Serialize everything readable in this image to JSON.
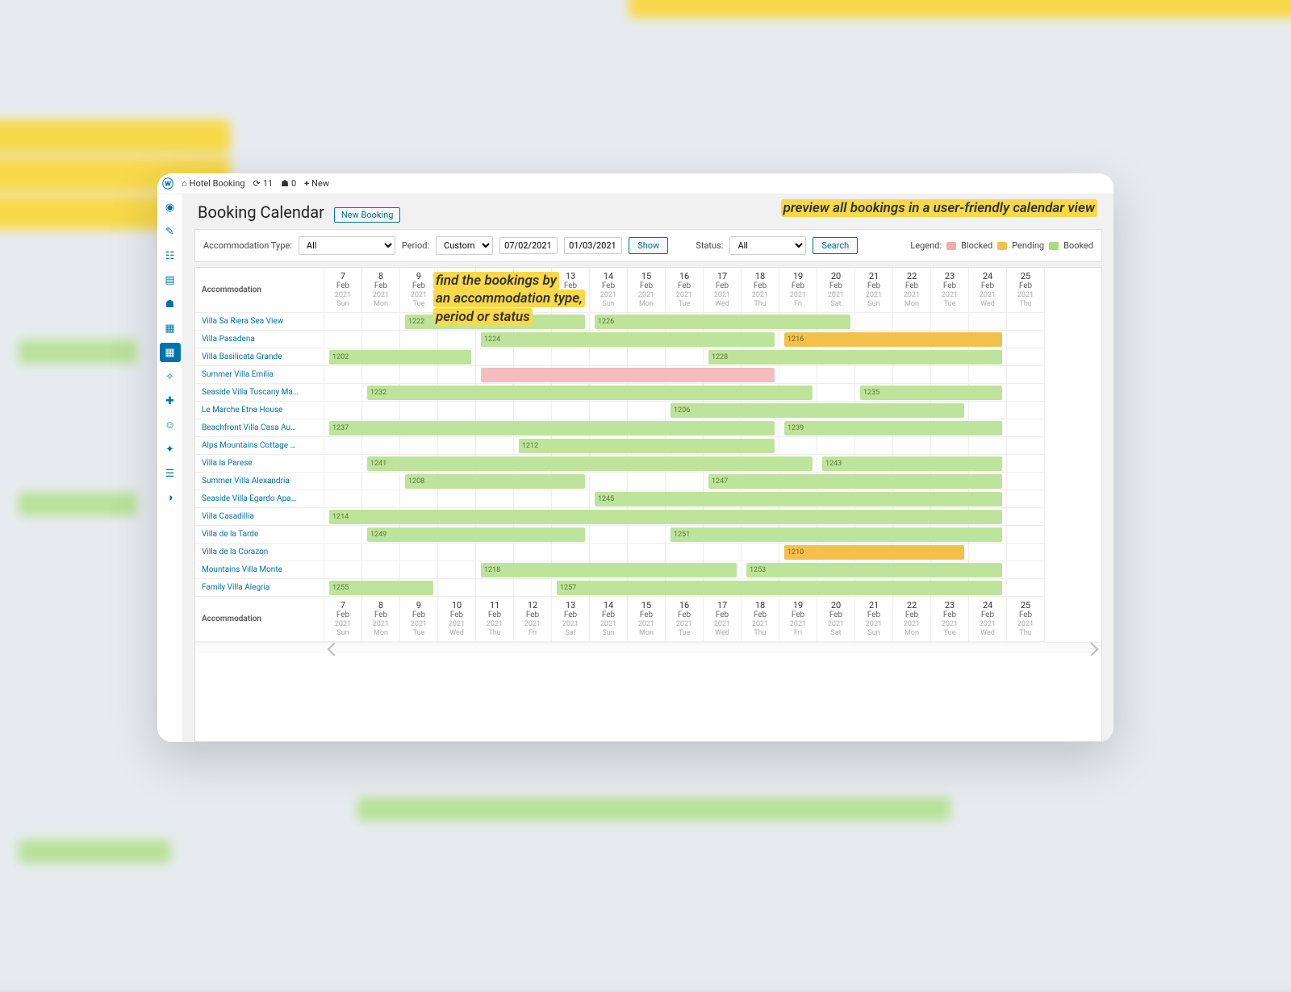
{
  "adminbar": {
    "site": "Hotel Booking",
    "updates": "11",
    "comments": "0",
    "new": "New"
  },
  "page": {
    "title": "Booking Calendar",
    "new_button": "New Booking"
  },
  "callouts": {
    "right": "preview all bookings in a user-friendly calendar view",
    "left": "find the bookings by<br>an accommodation type,<br>period or status"
  },
  "filters": {
    "acc_label": "Accommodation Type:",
    "acc_value": "All",
    "period_label": "Period:",
    "period_value": "Custom",
    "date_from": "07/02/2021",
    "date_to": "01/03/2021",
    "show": "Show",
    "status_label": "Status:",
    "status_value": "All",
    "search": "Search"
  },
  "legend": {
    "label": "Legend:",
    "blocked": "Blocked",
    "pending": "Pending",
    "booked": "Booked"
  },
  "columns": [
    {
      "d": "7",
      "m": "Feb",
      "y": "2021",
      "w": "Sun"
    },
    {
      "d": "8",
      "m": "Feb",
      "y": "2021",
      "w": "Mon"
    },
    {
      "d": "9",
      "m": "Feb",
      "y": "2021",
      "w": "Tue"
    },
    {
      "d": "10",
      "m": "Feb",
      "y": "2021",
      "w": "Wed"
    },
    {
      "d": "11",
      "m": "Feb",
      "y": "2021",
      "w": "Thu"
    },
    {
      "d": "12",
      "m": "Feb",
      "y": "2021",
      "w": "Fri"
    },
    {
      "d": "13",
      "m": "Feb",
      "y": "2021",
      "w": "Sat"
    },
    {
      "d": "14",
      "m": "Feb",
      "y": "2021",
      "w": "Sun"
    },
    {
      "d": "15",
      "m": "Feb",
      "y": "2021",
      "w": "Mon"
    },
    {
      "d": "16",
      "m": "Feb",
      "y": "2021",
      "w": "Tue"
    },
    {
      "d": "17",
      "m": "Feb",
      "y": "2021",
      "w": "Wed"
    },
    {
      "d": "18",
      "m": "Feb",
      "y": "2021",
      "w": "Thu"
    },
    {
      "d": "19",
      "m": "Feb",
      "y": "2021",
      "w": "Fri"
    },
    {
      "d": "20",
      "m": "Feb",
      "y": "2021",
      "w": "Sat"
    },
    {
      "d": "21",
      "m": "Feb",
      "y": "2021",
      "w": "Sun"
    },
    {
      "d": "22",
      "m": "Feb",
      "y": "2021",
      "w": "Mon"
    },
    {
      "d": "23",
      "m": "Feb",
      "y": "2021",
      "w": "Tue"
    },
    {
      "d": "24",
      "m": "Feb",
      "y": "2021",
      "w": "Wed"
    },
    {
      "d": "25",
      "m": "Feb",
      "y": "2021",
      "w": "Thu"
    }
  ],
  "row_header": "Accommodation",
  "rows": [
    {
      "name": "Villa Sa Riera Sea View",
      "bars": [
        {
          "id": "1222",
          "start": 3,
          "len": 5,
          "cls": "booked"
        },
        {
          "id": "1226",
          "start": 8,
          "len": 7,
          "cls": "booked"
        }
      ]
    },
    {
      "name": "Villa Pasadena",
      "bars": [
        {
          "id": "1224",
          "start": 5,
          "len": 8,
          "cls": "booked"
        },
        {
          "id": "1216",
          "start": 13,
          "len": 6,
          "cls": "pending"
        }
      ]
    },
    {
      "name": "Villa Basilicata Grande",
      "bars": [
        {
          "id": "1202",
          "start": 1,
          "len": 4,
          "cls": "booked"
        },
        {
          "id": "1228",
          "start": 11,
          "len": 8,
          "cls": "booked"
        }
      ]
    },
    {
      "name": "Summer Villa Emilia",
      "bars": [
        {
          "id": "",
          "start": 5,
          "len": 8,
          "cls": "blocked"
        }
      ]
    },
    {
      "name": "Seaside Villa Tuscany Ma…",
      "bars": [
        {
          "id": "1232",
          "start": 2,
          "len": 12,
          "cls": "booked"
        },
        {
          "id": "1235",
          "start": 15,
          "len": 4,
          "cls": "booked"
        }
      ]
    },
    {
      "name": "Le Marche Etna House",
      "bars": [
        {
          "id": "1206",
          "start": 10,
          "len": 8,
          "cls": "booked"
        }
      ]
    },
    {
      "name": "Beachfront Villa Casa Au…",
      "bars": [
        {
          "id": "1237",
          "start": 1,
          "len": 12,
          "cls": "booked"
        },
        {
          "id": "1239",
          "start": 13,
          "len": 6,
          "cls": "booked"
        }
      ]
    },
    {
      "name": "Alps Mountains Cottage …",
      "bars": [
        {
          "id": "1212",
          "start": 6,
          "len": 7,
          "cls": "booked"
        }
      ]
    },
    {
      "name": "Villa la Parese",
      "bars": [
        {
          "id": "1241",
          "start": 2,
          "len": 12,
          "cls": "booked"
        },
        {
          "id": "1243",
          "start": 14,
          "len": 5,
          "cls": "booked"
        }
      ]
    },
    {
      "name": "Summer Villa Alexandria",
      "bars": [
        {
          "id": "1208",
          "start": 3,
          "len": 5,
          "cls": "booked"
        },
        {
          "id": "1247",
          "start": 11,
          "len": 8,
          "cls": "booked"
        }
      ]
    },
    {
      "name": "Seaside Villa Egardo Apa…",
      "bars": [
        {
          "id": "1245",
          "start": 8,
          "len": 11,
          "cls": "booked"
        }
      ]
    },
    {
      "name": "Villa Casadillia",
      "bars": [
        {
          "id": "1214",
          "start": 1,
          "len": 18,
          "cls": "booked"
        }
      ]
    },
    {
      "name": "Villa de la Tarde",
      "bars": [
        {
          "id": "1249",
          "start": 2,
          "len": 6,
          "cls": "booked"
        },
        {
          "id": "1251",
          "start": 10,
          "len": 9,
          "cls": "booked"
        }
      ]
    },
    {
      "name": "Villa de la Corazon",
      "bars": [
        {
          "id": "1210",
          "start": 13,
          "len": 5,
          "cls": "pending"
        }
      ]
    },
    {
      "name": "Mountains Villa Monte",
      "bars": [
        {
          "id": "1218",
          "start": 5,
          "len": 7,
          "cls": "booked"
        },
        {
          "id": "1253",
          "start": 12,
          "len": 7,
          "cls": "booked"
        }
      ]
    },
    {
      "name": "Family Villa Alegria",
      "bars": [
        {
          "id": "1255",
          "start": 1,
          "len": 3,
          "cls": "booked"
        },
        {
          "id": "1257",
          "start": 7,
          "len": 12,
          "cls": "booked"
        }
      ]
    }
  ]
}
